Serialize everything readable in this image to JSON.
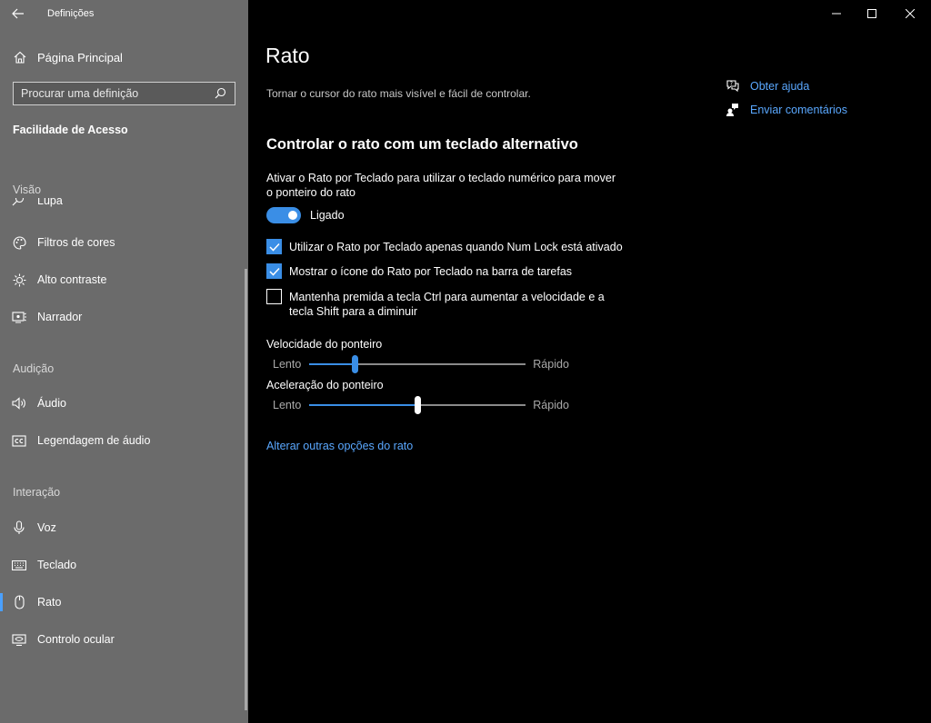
{
  "window": {
    "app_title": "Definições",
    "back_icon": "back-arrow-icon"
  },
  "sidebar": {
    "home_label": "Página Principal",
    "search_placeholder": "Procurar uma definição",
    "section_title": "Facilidade de Acesso",
    "groups": {
      "vision": "Visão",
      "hearing": "Audição",
      "interaction": "Interação"
    },
    "items": {
      "magnifier": "Lupa",
      "color_filters": "Filtros de cores",
      "high_contrast": "Alto contraste",
      "narrator": "Narrador",
      "audio": "Áudio",
      "captions": "Legendagem de áudio",
      "speech": "Voz",
      "keyboard": "Teclado",
      "mouse": "Rato",
      "eye_control": "Controlo ocular"
    },
    "active_item": "mouse",
    "accent_color": "#4aa0ff"
  },
  "main": {
    "title": "Rato",
    "subtitle": "Tornar o cursor do rato mais visível e fácil de controlar.",
    "help": {
      "get_help": "Obter ajuda",
      "feedback": "Enviar comentários"
    },
    "section_title": "Controlar o rato com um teclado alternativo",
    "toggle_description": "Ativar o Rato por Teclado para utilizar o teclado numérico para mover o ponteiro do rato",
    "toggle_state_label": "Ligado",
    "toggle_on": true,
    "checkboxes": [
      {
        "label": "Utilizar o Rato por Teclado apenas quando Num Lock está ativado",
        "checked": true
      },
      {
        "label": "Mostrar o ícone do Rato por Teclado na barra de tarefas",
        "checked": true
      },
      {
        "label": "Mantenha premida a tecla Ctrl para aumentar a velocidade e a tecla Shift para a diminuir",
        "checked": false
      }
    ],
    "speed": {
      "label": "Velocidade do ponteiro",
      "min_label": "Lento",
      "max_label": "Rápido",
      "value_fraction": 0.21
    },
    "acceleration": {
      "label": "Aceleração do ponteiro",
      "min_label": "Lento",
      "max_label": "Rápido",
      "value_fraction": 0.5
    },
    "more_options_link": "Alterar outras opções do rato",
    "accent_color": "#3a8ee6"
  }
}
